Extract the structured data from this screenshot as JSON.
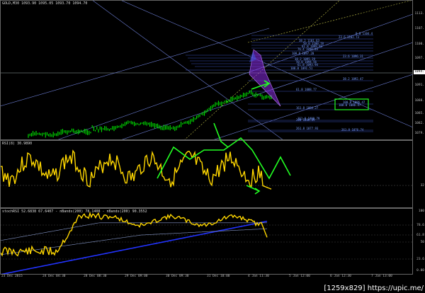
{
  "main_title": "GOLD,M30 1093.90 1095.05 1093.70 1094.70",
  "rsi_title": "RSI(8) 30.9890",
  "stoch_title": "stochRSI 52.6838 67.6407 - nBands(200) 78.1408 - nBands(200) 90.3552",
  "price_axis": [
    "1113.",
    "1107.",
    "1100.",
    "1097.",
    "1094.",
    "1091.",
    "1088.",
    "1085.",
    "1082.",
    "1079."
  ],
  "current_price": "1094.",
  "rsi_axis": [
    "32"
  ],
  "stoch_axis": [
    "100",
    "78.6",
    "61.8",
    "50",
    "23.6",
    "0.00"
  ],
  "time_axis": [
    "23 Dec 2015",
    "24 Dec 04:30",
    "28 Dec 08:30",
    "29 Dec 09:00",
    "30 Dec 09:30",
    "31 Dec 10:00",
    "4 Jan 11:30",
    "5 Jan 12:00",
    "6 Jan 12:30",
    "7 Jan 13:00"
  ],
  "fib_levels": [
    {
      "label": "0.0 1104.4"
    },
    {
      "label": "23.6 1102.73"
    },
    {
      "label": "38.2 1101.63"
    },
    {
      "label": "50.0 1100.78"
    },
    {
      "label": "61.8 1099.93"
    },
    {
      "label": "76.4 1098.89"
    },
    {
      "label": "100.0 1097.20"
    },
    {
      "label": "23.6 1096.31"
    },
    {
      "label": "38.2 1095.29"
    },
    {
      "label": "50.0 1094.56"
    },
    {
      "label": "61.8 1093.94"
    },
    {
      "label": "100.0 1091.51"
    },
    {
      "label": "38.2 1092.47"
    },
    {
      "label": "61.8 1088.77"
    },
    {
      "label": "100.0 1086.47"
    },
    {
      "label": "161.8 1084.27"
    },
    {
      "label": "200 1080.89"
    },
    {
      "label": "261.8 1076.74"
    },
    {
      "label": "161.8 1080.79"
    },
    {
      "label": "261.8 1077.93"
    }
  ],
  "colors": {
    "background": "#000000",
    "candles": "#00ff00",
    "rsi_line": "#ffd700",
    "pattern_arrows": "#22ff22",
    "channel_lines": "#6d7fd6",
    "harmonic_fill": "#8a2be2",
    "target_box": "#22ff22"
  },
  "watermark": "[1259x829] https://upic.me/"
}
